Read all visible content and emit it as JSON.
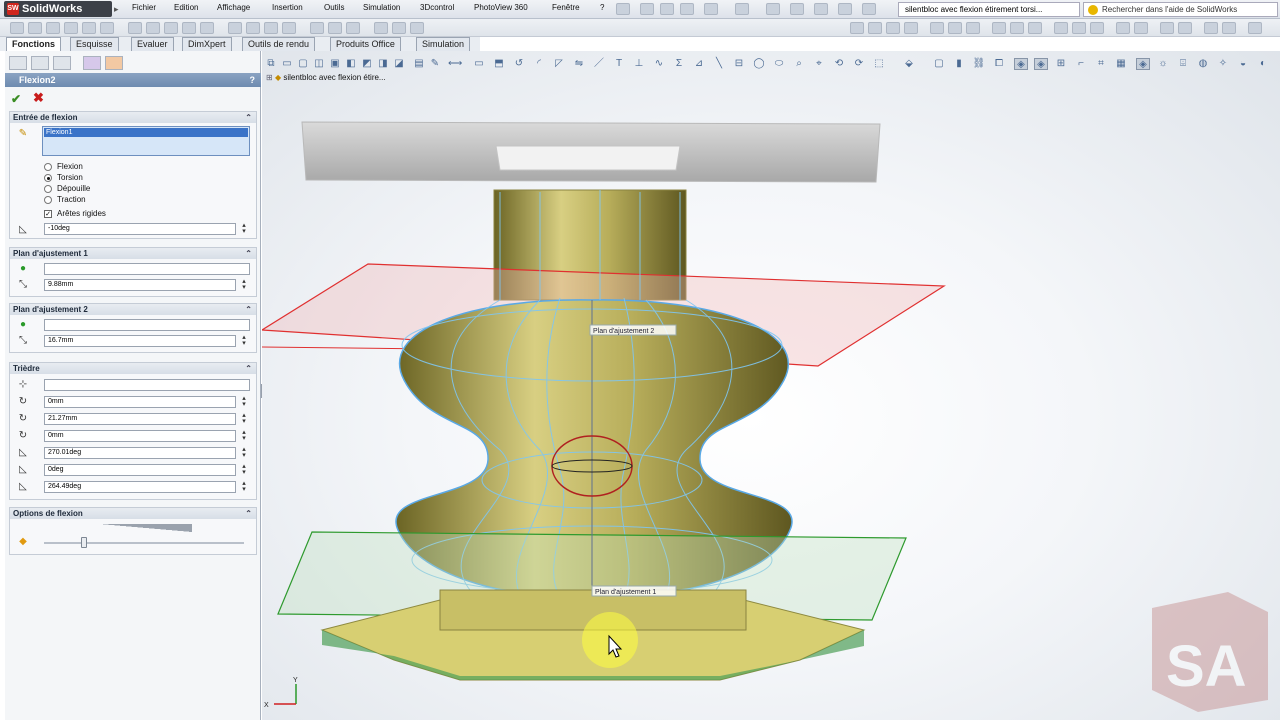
{
  "app": {
    "name": "SolidWorks",
    "logo_text": "SW"
  },
  "menu": [
    "Fichier",
    "Edition",
    "Affichage",
    "Insertion",
    "Outils",
    "Simulation",
    "3Dcontrol",
    "PhotoView 360",
    "Fenêtre",
    "?"
  ],
  "document_title": "silentbloc avec flexion étirement torsi...",
  "help_search": {
    "placeholder": "Rechercher dans l'aide de SolidWorks"
  },
  "command_tabs": [
    "Fonctions",
    "Esquisse",
    "Evaluer",
    "DimXpert",
    "Outils de rendu",
    "Produits Office",
    "Simulation"
  ],
  "property_manager": {
    "title": "Flexion2",
    "help": "?",
    "ok_glyph": "✔",
    "cancel_glyph": "✖",
    "entree": {
      "header": "Entrée de flexion",
      "selection": "Flexion1",
      "options": [
        "Flexion",
        "Torsion",
        "Dépouille",
        "Traction"
      ],
      "selected_option": "Torsion",
      "aretes_rigides": "Arêtes rigides",
      "angle": "-10deg"
    },
    "plan1": {
      "header": "Plan d'ajustement 1",
      "value": "",
      "distance": "9.88mm"
    },
    "plan2": {
      "header": "Plan d'ajustement 2",
      "value": "",
      "distance": "16.7mm"
    },
    "triedre": {
      "header": "Trièdre",
      "value": "",
      "values": [
        "0mm",
        "21.27mm",
        "0mm",
        "270.01deg",
        "0deg",
        "264.49deg"
      ]
    },
    "options_flexion": {
      "header": "Options de flexion",
      "accuracy": 0.2
    }
  },
  "viewport": {
    "tree_label": "silentbloc avec flexion étire...",
    "plane_label_2": "Plan d'ajustement 2",
    "plane_label_1": "Plan d'ajustement 1",
    "triad": {
      "y": "Y",
      "x": "X"
    },
    "watermark": "SA"
  },
  "icons": {
    "collapse": "chevron-up-icon",
    "spinner": "up-down-spinner-icon"
  }
}
